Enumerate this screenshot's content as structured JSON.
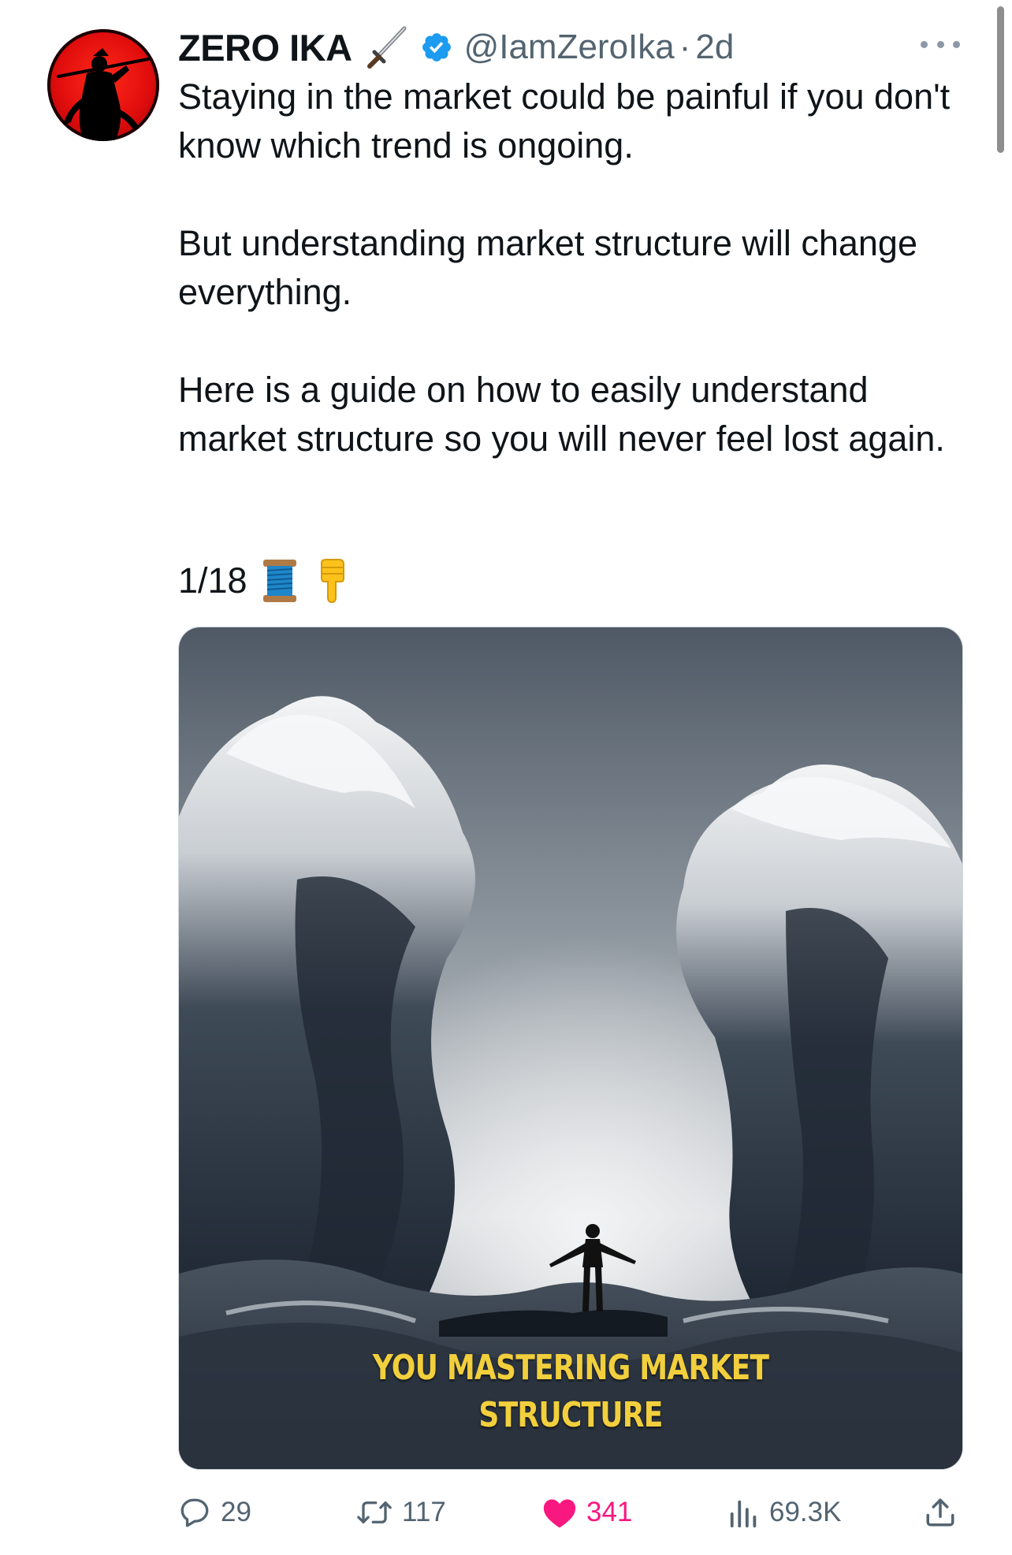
{
  "tweet": {
    "author_name": "ZERO IKA",
    "name_emoji": "dagger-icon",
    "verified": true,
    "handle": "@IamZeroIka",
    "separator": "·",
    "time": "2d",
    "paragraphs": [
      "Staying in the market could be painful if you don't know which trend is ongoing.",
      "But understanding market structure will change everything.",
      "Here is a guide on how to easily understand market structure so you will never feel lost again."
    ],
    "thread_count": "1/18",
    "thread_emojis": [
      "thread-spool-icon",
      "pointing-down-icon"
    ]
  },
  "media": {
    "caption_line1": "YOU MASTERING MARKET",
    "caption_line2": "STRUCTURE",
    "caption_color": "#f2cf3c"
  },
  "actions": {
    "replies": "29",
    "reposts": "117",
    "likes": "341",
    "views": "69.3K",
    "like_color": "#f91880",
    "icon_color": "#536471"
  },
  "colors": {
    "verified_blue": "#1d9bf0",
    "avatar_red": "#e00d0d"
  }
}
